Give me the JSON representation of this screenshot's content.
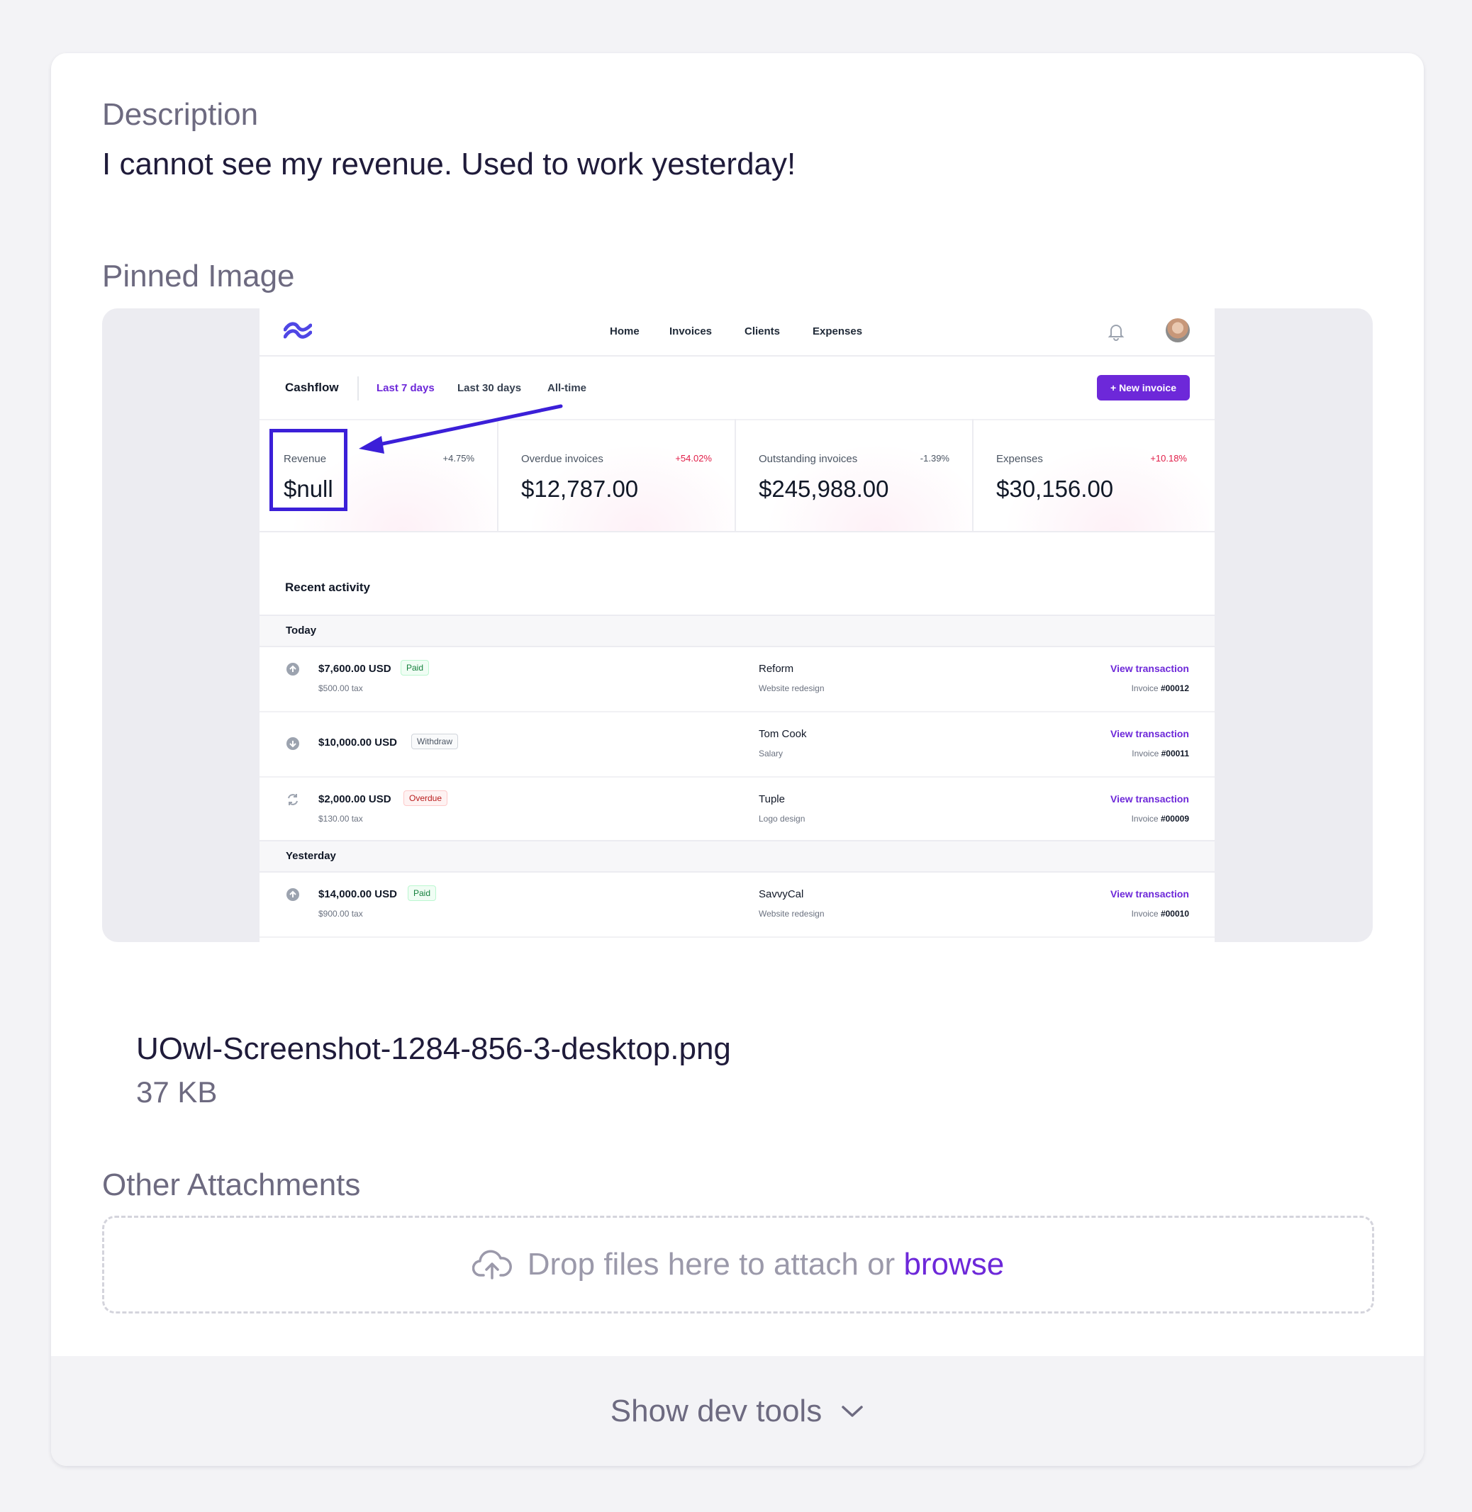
{
  "description": {
    "label": "Description",
    "text": "I cannot see my revenue. Used to work yesterday!"
  },
  "pinned": {
    "label": "Pinned Image",
    "file_name": "UOwl-Screenshot-1284-856-3-desktop.png",
    "file_size": "37 KB",
    "screenshot": {
      "nav": [
        "Home",
        "Invoices",
        "Clients",
        "Expenses"
      ],
      "cashflow_title": "Cashflow",
      "ranges": [
        "Last 7 days",
        "Last 30 days",
        "All-time"
      ],
      "new_invoice": "+ New invoice",
      "stats": [
        {
          "label": "Revenue",
          "change": "+4.75%",
          "value": "$null"
        },
        {
          "label": "Overdue invoices",
          "change": "+54.02%",
          "value": "$12,787.00"
        },
        {
          "label": "Outstanding invoices",
          "change": "-1.39%",
          "value": "$245,988.00"
        },
        {
          "label": "Expenses",
          "change": "+10.18%",
          "value": "$30,156.00"
        }
      ],
      "recent_title": "Recent activity",
      "day_today": "Today",
      "day_yesterday": "Yesterday",
      "rows": [
        {
          "amount": "$7,600.00 USD",
          "badge": "Paid",
          "tax": "$500.00 tax",
          "client": "Reform",
          "sub": "Website redesign",
          "link": "View transaction",
          "inv_prefix": "Invoice",
          "inv": "#00012"
        },
        {
          "amount": "$10,000.00 USD",
          "badge": "Withdraw",
          "tax": "",
          "client": "Tom Cook",
          "sub": "Salary",
          "link": "View transaction",
          "inv_prefix": "Invoice",
          "inv": "#00011"
        },
        {
          "amount": "$2,000.00 USD",
          "badge": "Overdue",
          "tax": "$130.00 tax",
          "client": "Tuple",
          "sub": "Logo design",
          "link": "View transaction",
          "inv_prefix": "Invoice",
          "inv": "#00009"
        },
        {
          "amount": "$14,000.00 USD",
          "badge": "Paid",
          "tax": "$900.00 tax",
          "client": "SavvyCal",
          "sub": "Website redesign",
          "link": "View transaction",
          "inv_prefix": "Invoice",
          "inv": "#00010"
        }
      ]
    }
  },
  "attachments": {
    "label": "Other Attachments",
    "drop_text": "Drop files here to attach or",
    "browse": "browse",
    "icon": "cloud-upload-icon"
  },
  "dev_tools": {
    "label": "Show dev tools",
    "icon": "chevron-down-icon"
  },
  "colors": {
    "accent": "#6d28d9",
    "annotation": "#3b1fd8",
    "muted": "#6d6a80"
  }
}
